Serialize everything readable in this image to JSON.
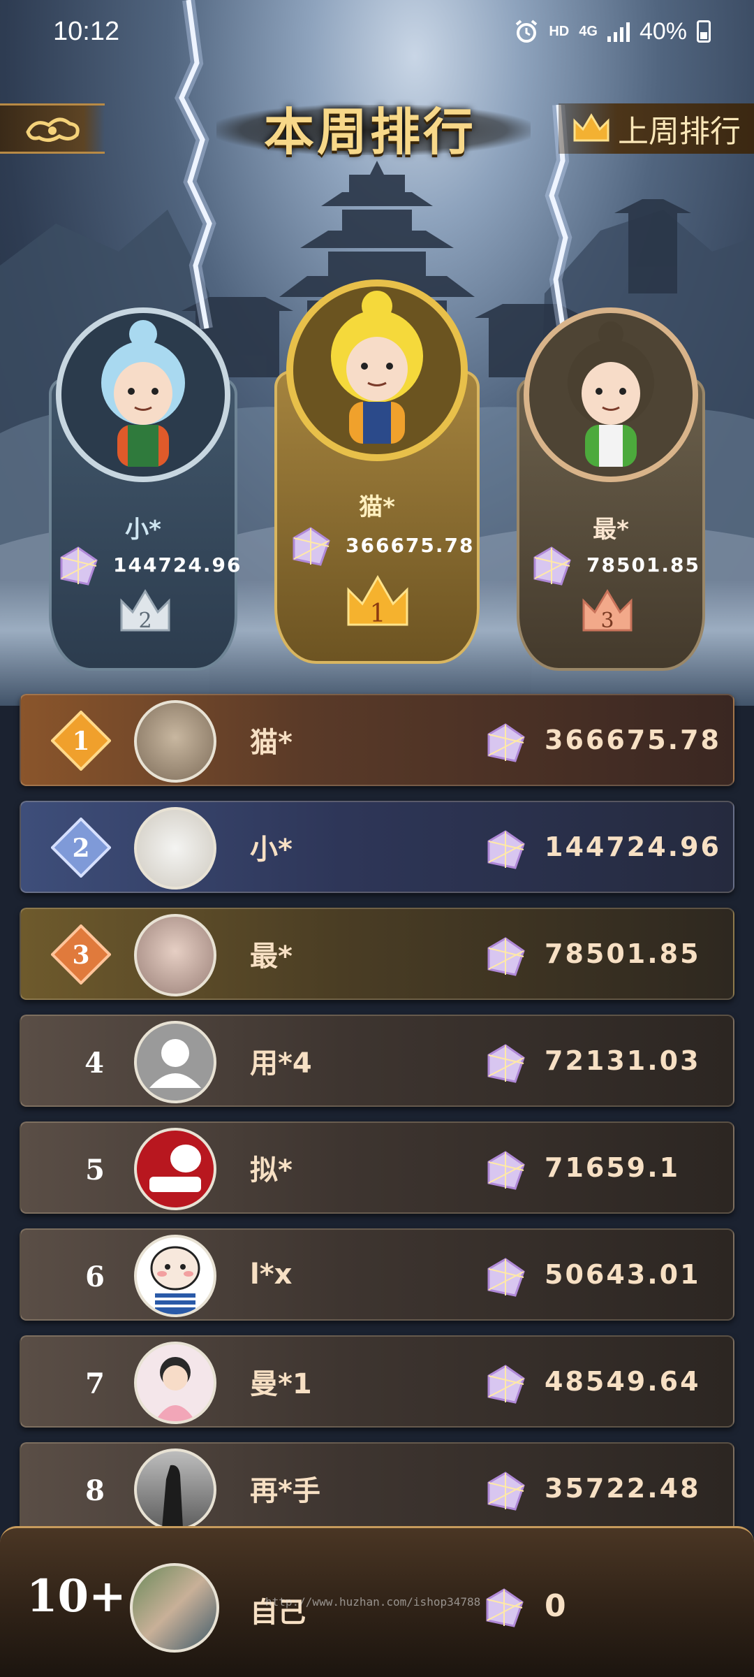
{
  "status_bar": {
    "time": "10:12",
    "hd": "HD",
    "network": "4G",
    "battery": "40%"
  },
  "header": {
    "title": "本周排行",
    "last_week_label": "上周排行"
  },
  "podium": [
    {
      "place": "2",
      "name": "小*",
      "score": "144724.96"
    },
    {
      "place": "1",
      "name": "猫*",
      "score": "366675.78"
    },
    {
      "place": "3",
      "name": "最*",
      "score": "78501.85"
    }
  ],
  "ranking": [
    {
      "rank": "1",
      "name": "猫*",
      "score": "366675.78"
    },
    {
      "rank": "2",
      "name": "小*",
      "score": "144724.96"
    },
    {
      "rank": "3",
      "name": "最*",
      "score": "78501.85"
    },
    {
      "rank": "4",
      "name": "用*4",
      "score": "72131.03"
    },
    {
      "rank": "5",
      "name": "拟*",
      "score": "71659.1"
    },
    {
      "rank": "6",
      "name": "l*x",
      "score": "50643.01"
    },
    {
      "rank": "7",
      "name": "曼*1",
      "score": "48549.64"
    },
    {
      "rank": "8",
      "name": "再*手",
      "score": "35722.48"
    }
  ],
  "self": {
    "rank": "10+",
    "name": "自己",
    "score": "0",
    "watermark": "http://www.huzhan.com/ishop34788"
  },
  "colors": {
    "gold": "#f7d889",
    "row_gold": "#7a4a24",
    "row_blue": "#3a4a72",
    "row_bronze": "#6a5428",
    "row_default": "#3c3530"
  }
}
